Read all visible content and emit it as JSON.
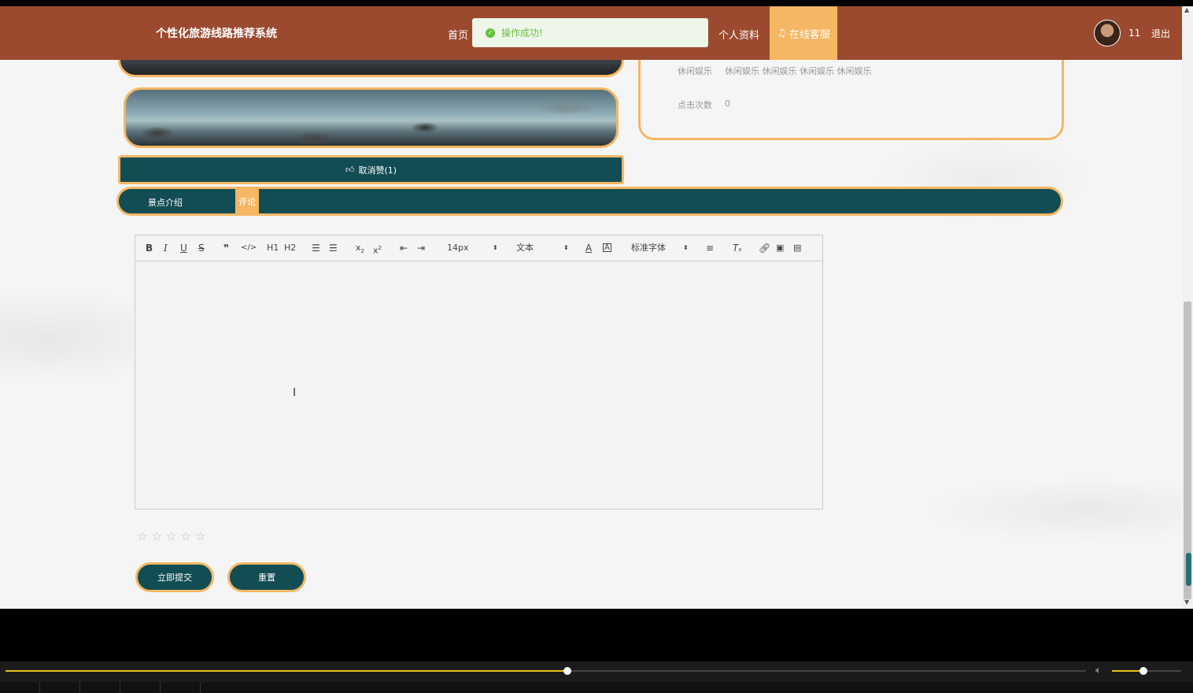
{
  "header": {
    "brand": "个性化旅游线路推荐系统",
    "nav_home": "首页",
    "nav_profile": "个人资料",
    "nav_service": "在线客服",
    "user_id": "11",
    "logout": "退出",
    "color": "#9b4a2f",
    "accent": "#f5b763"
  },
  "toast": {
    "message": "操作成功!",
    "color": "#67c23a"
  },
  "info": {
    "category_label": "休闲娱乐",
    "category_value": "休闲娱乐 休闲娱乐 休闲娱乐 休闲娱乐",
    "clicks_label": "点击次数",
    "clicks_value": "0"
  },
  "like_button": {
    "label": "取消赞(1)",
    "icon": "thumbs-up-icon"
  },
  "tabs": {
    "intro": "景点介绍",
    "comment": "评论"
  },
  "editor": {
    "font_size": "14px",
    "heading": "文本",
    "font_family": "标准字体",
    "content": "",
    "h1": "H1",
    "h2": "H2"
  },
  "rating": {
    "stars": 0,
    "max": 5
  },
  "buttons": {
    "submit": "立即提交",
    "reset": "重置"
  },
  "player": {
    "progress": 0.52,
    "volume": 0.45,
    "primary_color": "#124d54"
  }
}
